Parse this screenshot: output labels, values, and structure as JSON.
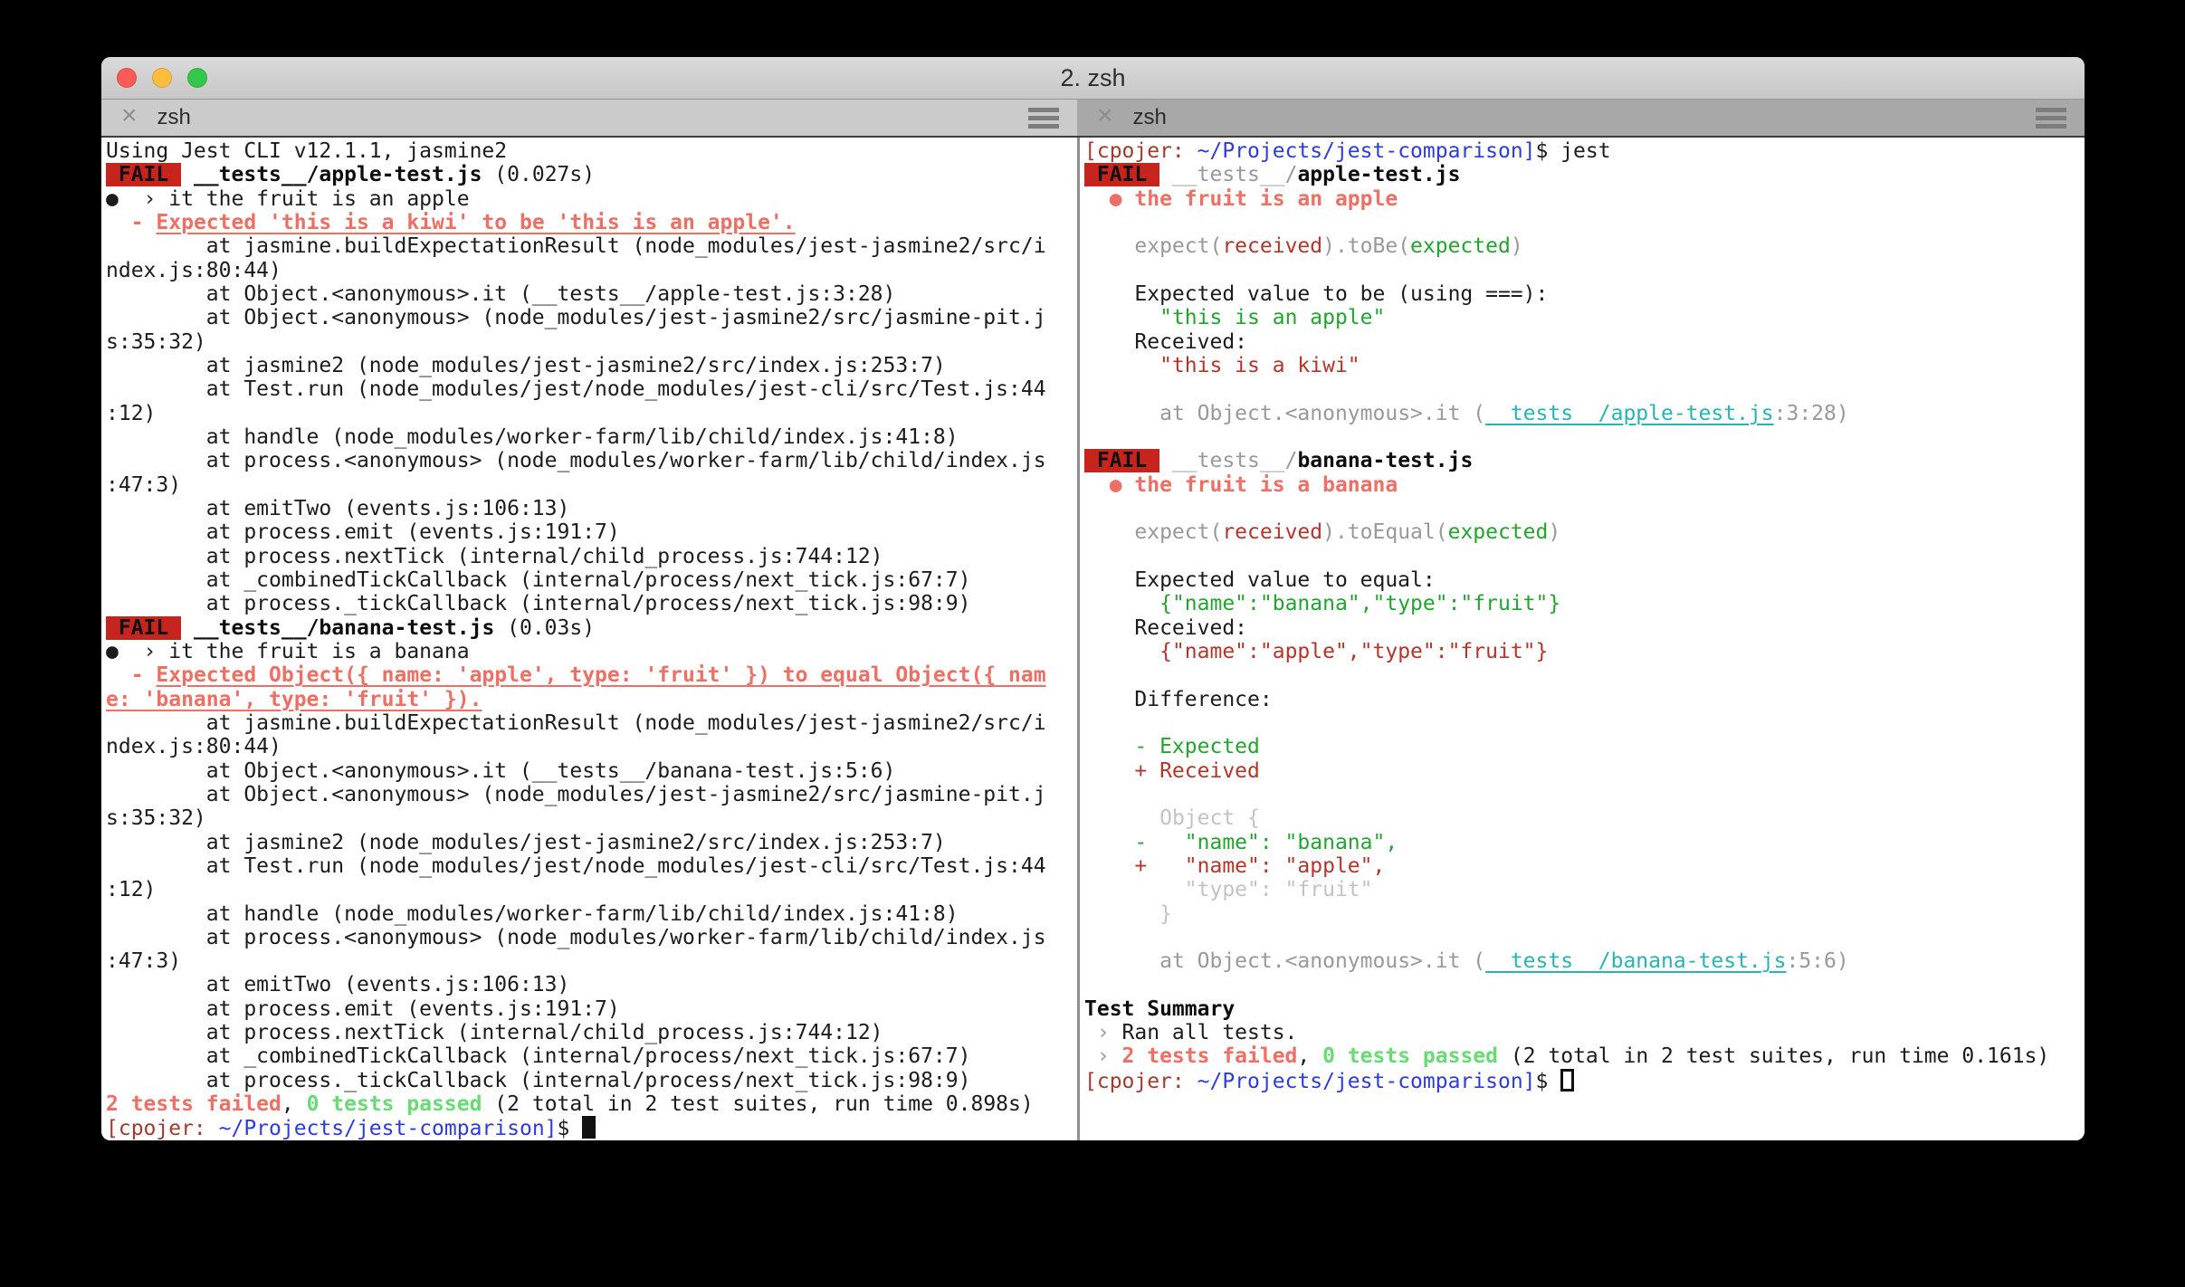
{
  "window": {
    "title": "2. zsh"
  },
  "left_tab": {
    "label": "zsh"
  },
  "right_tab": {
    "label": "zsh"
  },
  "colors": {
    "fail_badge_bg": "#c7241d",
    "fail_salmon": "#ee6f63",
    "received_red": "#b6352b",
    "expected_green": "#23a42f",
    "passed_green": "#69db74",
    "prompt_user_red": "#a33b2c",
    "prompt_path_blue": "#2b3cdb",
    "file_link_cyan": "#29b4b2",
    "stack_gray": "#999999",
    "diff_context_gray": "#c3c3c3"
  },
  "left_pane": {
    "lines": [
      [
        {
          "t": "Using Jest CLI v12.1.1, jasmine2",
          "c": "d"
        }
      ],
      [
        {
          "t": " FAIL ",
          "c": "badge"
        },
        {
          "t": " ",
          "c": "d"
        },
        {
          "t": "__tests__/apple-test.js",
          "c": "bold"
        },
        {
          "t": " (0.027s)",
          "c": "d"
        }
      ],
      [
        {
          "t": "●  › it the fruit is an apple",
          "c": "d"
        }
      ],
      [
        {
          "t": "  ",
          "c": "d"
        },
        {
          "t": "- ",
          "c": "salmon"
        },
        {
          "t": "Expected 'this is a kiwi' to be 'this is an apple'.",
          "c": "redu"
        }
      ],
      [
        {
          "t": "        at jasmine.buildExpectationResult (node_modules/jest-jasmine2/src/i",
          "c": "d"
        }
      ],
      [
        {
          "t": "ndex.js:80:44)",
          "c": "d"
        }
      ],
      [
        {
          "t": "        at Object.<anonymous>.it (__tests__/apple-test.js:3:28)",
          "c": "d"
        }
      ],
      [
        {
          "t": "        at Object.<anonymous> (node_modules/jest-jasmine2/src/jasmine-pit.j",
          "c": "d"
        }
      ],
      [
        {
          "t": "s:35:32)",
          "c": "d"
        }
      ],
      [
        {
          "t": "        at jasmine2 (node_modules/jest-jasmine2/src/index.js:253:7)",
          "c": "d"
        }
      ],
      [
        {
          "t": "        at Test.run (node_modules/jest/node_modules/jest-cli/src/Test.js:44",
          "c": "d"
        }
      ],
      [
        {
          "t": ":12)",
          "c": "d"
        }
      ],
      [
        {
          "t": "        at handle (node_modules/worker-farm/lib/child/index.js:41:8)",
          "c": "d"
        }
      ],
      [
        {
          "t": "        at process.<anonymous> (node_modules/worker-farm/lib/child/index.js",
          "c": "d"
        }
      ],
      [
        {
          "t": ":47:3)",
          "c": "d"
        }
      ],
      [
        {
          "t": "        at emitTwo (events.js:106:13)",
          "c": "d"
        }
      ],
      [
        {
          "t": "        at process.emit (events.js:191:7)",
          "c": "d"
        }
      ],
      [
        {
          "t": "        at process.nextTick (internal/child_process.js:744:12)",
          "c": "d"
        }
      ],
      [
        {
          "t": "        at _combinedTickCallback (internal/process/next_tick.js:67:7)",
          "c": "d"
        }
      ],
      [
        {
          "t": "        at process._tickCallback (internal/process/next_tick.js:98:9)",
          "c": "d"
        }
      ],
      [
        {
          "t": " FAIL ",
          "c": "badge"
        },
        {
          "t": " ",
          "c": "d"
        },
        {
          "t": "__tests__/banana-test.js",
          "c": "bold"
        },
        {
          "t": " (0.03s)",
          "c": "d"
        }
      ],
      [
        {
          "t": "●  › it the fruit is a banana",
          "c": "d"
        }
      ],
      [
        {
          "t": "  ",
          "c": "d"
        },
        {
          "t": "- ",
          "c": "salmon"
        },
        {
          "t": "Expected Object({ name: 'apple', type: 'fruit' }) to equal Object({ nam",
          "c": "redu"
        }
      ],
      [
        {
          "t": "e: 'banana', type: 'fruit' }).",
          "c": "redu"
        }
      ],
      [
        {
          "t": "        at jasmine.buildExpectationResult (node_modules/jest-jasmine2/src/i",
          "c": "d"
        }
      ],
      [
        {
          "t": "ndex.js:80:44)",
          "c": "d"
        }
      ],
      [
        {
          "t": "        at Object.<anonymous>.it (__tests__/banana-test.js:5:6)",
          "c": "d"
        }
      ],
      [
        {
          "t": "        at Object.<anonymous> (node_modules/jest-jasmine2/src/jasmine-pit.j",
          "c": "d"
        }
      ],
      [
        {
          "t": "s:35:32)",
          "c": "d"
        }
      ],
      [
        {
          "t": "        at jasmine2 (node_modules/jest-jasmine2/src/index.js:253:7)",
          "c": "d"
        }
      ],
      [
        {
          "t": "        at Test.run (node_modules/jest/node_modules/jest-cli/src/Test.js:44",
          "c": "d"
        }
      ],
      [
        {
          "t": ":12)",
          "c": "d"
        }
      ],
      [
        {
          "t": "        at handle (node_modules/worker-farm/lib/child/index.js:41:8)",
          "c": "d"
        }
      ],
      [
        {
          "t": "        at process.<anonymous> (node_modules/worker-farm/lib/child/index.js",
          "c": "d"
        }
      ],
      [
        {
          "t": ":47:3)",
          "c": "d"
        }
      ],
      [
        {
          "t": "        at emitTwo (events.js:106:13)",
          "c": "d"
        }
      ],
      [
        {
          "t": "        at process.emit (events.js:191:7)",
          "c": "d"
        }
      ],
      [
        {
          "t": "        at process.nextTick (internal/child_process.js:744:12)",
          "c": "d"
        }
      ],
      [
        {
          "t": "        at _combinedTickCallback (internal/process/next_tick.js:67:7)",
          "c": "d"
        }
      ],
      [
        {
          "t": "        at process._tickCallback (internal/process/next_tick.js:98:9)",
          "c": "d"
        }
      ],
      [
        {
          "t": "2 tests failed",
          "c": "salmon"
        },
        {
          "t": ", ",
          "c": "d"
        },
        {
          "t": "0 tests passed",
          "c": "bgreen"
        },
        {
          "t": " (2 total in 2 test suites, run time 0.898s)",
          "c": "d"
        }
      ],
      [
        {
          "t": "[cpojer:",
          "c": "dred"
        },
        {
          "t": " ",
          "c": "d"
        },
        {
          "t": "~/Projects/jest-comparison]",
          "c": "blue"
        },
        {
          "t": "$ ",
          "c": "d"
        },
        {
          "t": "",
          "c": "cursor"
        }
      ]
    ]
  },
  "right_pane": {
    "lines": [
      [
        {
          "t": "[cpojer:",
          "c": "dred"
        },
        {
          "t": " ",
          "c": "d"
        },
        {
          "t": "~/Projects/jest-comparison]",
          "c": "blue"
        },
        {
          "t": "$ jest",
          "c": "d"
        }
      ],
      [
        {
          "t": " FAIL ",
          "c": "badge"
        },
        {
          "t": " ",
          "c": "d"
        },
        {
          "t": "__tests__/",
          "c": "gray"
        },
        {
          "t": "apple-test.js",
          "c": "bold"
        }
      ],
      [
        {
          "t": "  ",
          "c": "d"
        },
        {
          "t": "● the fruit is an apple",
          "c": "salmon"
        }
      ],
      [],
      [
        {
          "t": "    ",
          "c": "d"
        },
        {
          "t": "expect(",
          "c": "gray"
        },
        {
          "t": "received",
          "c": "red"
        },
        {
          "t": ").toBe(",
          "c": "gray"
        },
        {
          "t": "expected",
          "c": "green"
        },
        {
          "t": ")",
          "c": "gray"
        }
      ],
      [],
      [
        {
          "t": "    Expected value to be (using ===):",
          "c": "d"
        }
      ],
      [
        {
          "t": "      ",
          "c": "d"
        },
        {
          "t": "\"this is an apple\"",
          "c": "green"
        }
      ],
      [
        {
          "t": "    Received:",
          "c": "d"
        }
      ],
      [
        {
          "t": "      ",
          "c": "d"
        },
        {
          "t": "\"this is a kiwi\"",
          "c": "red"
        }
      ],
      [],
      [
        {
          "t": "      ",
          "c": "d"
        },
        {
          "t": "at Object.<anonymous>.it (",
          "c": "gray"
        },
        {
          "t": "__tests__/apple-test.js",
          "c": "cyan"
        },
        {
          "t": ":3:28)",
          "c": "gray"
        }
      ],
      [],
      [
        {
          "t": " FAIL ",
          "c": "badge"
        },
        {
          "t": " ",
          "c": "d"
        },
        {
          "t": "__tests__/",
          "c": "gray"
        },
        {
          "t": "banana-test.js",
          "c": "bold"
        }
      ],
      [
        {
          "t": "  ",
          "c": "d"
        },
        {
          "t": "● the fruit is a banana",
          "c": "salmon"
        }
      ],
      [],
      [
        {
          "t": "    ",
          "c": "d"
        },
        {
          "t": "expect(",
          "c": "gray"
        },
        {
          "t": "received",
          "c": "red"
        },
        {
          "t": ").toEqual(",
          "c": "gray"
        },
        {
          "t": "expected",
          "c": "green"
        },
        {
          "t": ")",
          "c": "gray"
        }
      ],
      [],
      [
        {
          "t": "    Expected value to equal:",
          "c": "d"
        }
      ],
      [
        {
          "t": "      ",
          "c": "d"
        },
        {
          "t": "{\"name\":\"banana\",\"type\":\"fruit\"}",
          "c": "green"
        }
      ],
      [
        {
          "t": "    Received:",
          "c": "d"
        }
      ],
      [
        {
          "t": "      ",
          "c": "d"
        },
        {
          "t": "{\"name\":\"apple\",\"type\":\"fruit\"}",
          "c": "red"
        }
      ],
      [],
      [
        {
          "t": "    Difference:",
          "c": "d"
        }
      ],
      [],
      [
        {
          "t": "    ",
          "c": "d"
        },
        {
          "t": "- Expected",
          "c": "green"
        }
      ],
      [
        {
          "t": "    ",
          "c": "d"
        },
        {
          "t": "+ Received",
          "c": "red"
        }
      ],
      [],
      [
        {
          "t": "      ",
          "c": "d"
        },
        {
          "t": "Object {",
          "c": "lgray"
        }
      ],
      [
        {
          "t": "    ",
          "c": "d"
        },
        {
          "t": "-   \"name\": \"banana\",",
          "c": "green"
        }
      ],
      [
        {
          "t": "    ",
          "c": "d"
        },
        {
          "t": "+   \"name\": \"apple\",",
          "c": "red"
        }
      ],
      [
        {
          "t": "        ",
          "c": "d"
        },
        {
          "t": "\"type\": \"fruit\"",
          "c": "lgray"
        }
      ],
      [
        {
          "t": "      ",
          "c": "d"
        },
        {
          "t": "}",
          "c": "lgray"
        }
      ],
      [],
      [
        {
          "t": "      ",
          "c": "d"
        },
        {
          "t": "at Object.<anonymous>.it (",
          "c": "gray"
        },
        {
          "t": "__tests__/banana-test.js",
          "c": "cyan"
        },
        {
          "t": ":5:6)",
          "c": "gray"
        }
      ],
      [],
      [
        {
          "t": "Test Summary",
          "c": "bold"
        }
      ],
      [
        {
          "t": " › ",
          "c": "gray"
        },
        {
          "t": "Ran all tests.",
          "c": "d"
        }
      ],
      [
        {
          "t": " › ",
          "c": "gray"
        },
        {
          "t": "2 tests failed",
          "c": "salmon"
        },
        {
          "t": ", ",
          "c": "d"
        },
        {
          "t": "0 tests passed",
          "c": "bgreen"
        },
        {
          "t": " (2 total in 2 test suites, run time 0.161s)",
          "c": "d"
        }
      ],
      [
        {
          "t": "[cpojer:",
          "c": "dred"
        },
        {
          "t": " ",
          "c": "d"
        },
        {
          "t": "~/Projects/jest-comparison]",
          "c": "blue"
        },
        {
          "t": "$ ",
          "c": "d"
        },
        {
          "t": "",
          "c": "hcursor"
        }
      ]
    ]
  }
}
